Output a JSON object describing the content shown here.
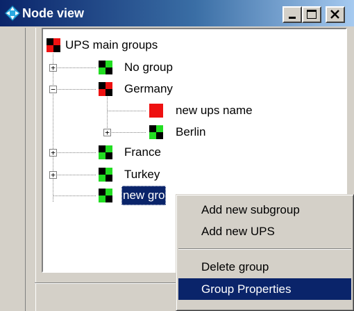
{
  "window": {
    "title": "Node view"
  },
  "tree": {
    "root": "UPS main groups",
    "no_group": "No group",
    "germany": "Germany",
    "new_ups_name": "new ups name",
    "berlin": "Berlin",
    "france": "France",
    "turkey": "Turkey",
    "new_group": "new gro"
  },
  "expanders": {
    "collapsed": "+",
    "expanded": "−"
  },
  "context_menu": {
    "add_subgroup": "Add new subgroup",
    "add_ups": "Add new UPS",
    "delete_group": "Delete group",
    "group_properties": "Group Properties"
  },
  "colors": {
    "title_bar": "#0a246a",
    "status_ok": "#22dd22",
    "status_alarm": "#ee1111",
    "selection": "#0a246a"
  },
  "icons": {
    "app": "diamond-arrows-icon",
    "group_ok": "group-status-ok-icon",
    "group_alarm": "group-status-alarm-icon",
    "ups_alarm": "ups-status-alarm-icon"
  }
}
